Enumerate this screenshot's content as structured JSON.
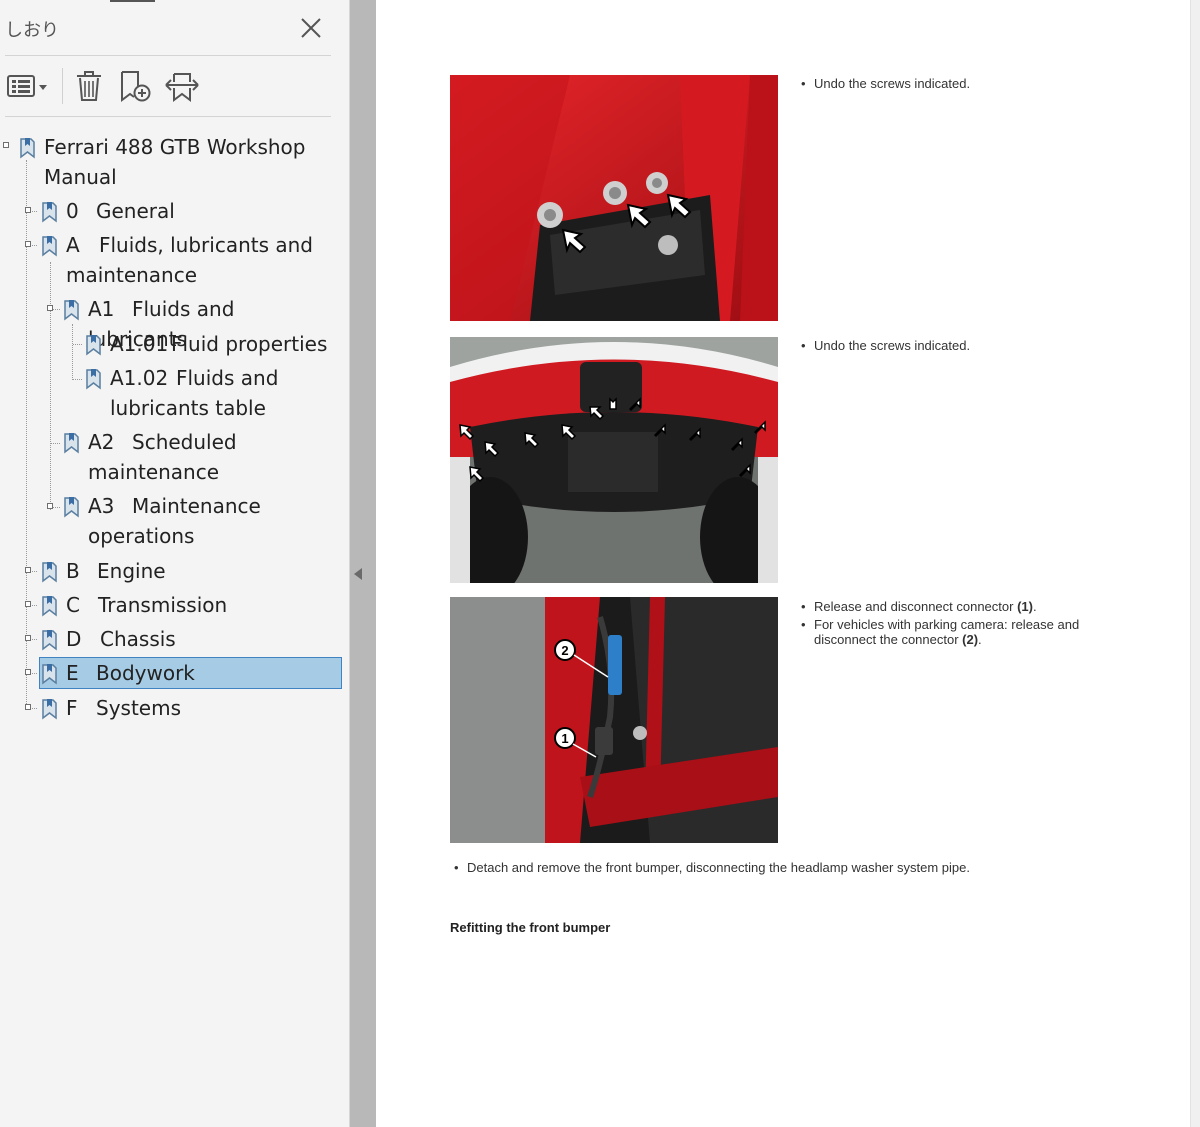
{
  "panel": {
    "title": "しおり",
    "tools": [
      "options-menu",
      "delete-bookmark",
      "add-bookmark",
      "expand-bookmark"
    ]
  },
  "tree": [
    {
      "prefix": "",
      "label": "Ferrari 488 GTB Workshop Manual",
      "level": 0,
      "expandable": true
    },
    {
      "prefix": "0",
      "label": "General",
      "level": 1,
      "expandable": true
    },
    {
      "prefix": "A",
      "label": "Fluids, lubricants and maintenance",
      "level": 1,
      "expandable": true
    },
    {
      "prefix": "A1",
      "label": "Fluids and lubricants",
      "level": 2,
      "expandable": true
    },
    {
      "prefix": "A1.01",
      "label": "Fluid properties",
      "level": 3,
      "expandable": false
    },
    {
      "prefix": "A1.02",
      "label": "Fluids and lubricants table",
      "level": 3,
      "expandable": false
    },
    {
      "prefix": "A2",
      "label": "Scheduled maintenance",
      "level": 2,
      "expandable": false
    },
    {
      "prefix": "A3",
      "label": "Maintenance operations",
      "level": 2,
      "expandable": true
    },
    {
      "prefix": "B",
      "label": "Engine",
      "level": 1,
      "expandable": true
    },
    {
      "prefix": "C",
      "label": "Transmission",
      "level": 1,
      "expandable": true
    },
    {
      "prefix": "D",
      "label": "Chassis",
      "level": 1,
      "expandable": true
    },
    {
      "prefix": "E",
      "label": "Bodywork",
      "level": 1,
      "expandable": true,
      "selected": true
    },
    {
      "prefix": "F",
      "label": "Systems",
      "level": 1,
      "expandable": true
    }
  ],
  "document": {
    "step1": {
      "items": [
        {
          "text": "Undo the screws indicated."
        }
      ]
    },
    "step2": {
      "items": [
        {
          "text": "Undo the screws indicated."
        }
      ]
    },
    "step3": {
      "items": [
        {
          "text": "Release and disconnect connector ",
          "bold": "(1)",
          "suffix": "."
        },
        {
          "text": "For vehicles with parking camera: release and disconnect the connector ",
          "bold": "(2)",
          "suffix": "."
        }
      ],
      "callouts": [
        "1",
        "2"
      ]
    },
    "step4": {
      "items": [
        {
          "text": "Detach and remove the front bumper, disconnecting the headlamp washer system pipe."
        }
      ]
    },
    "section_heading": "Refitting the front bumper"
  },
  "colors": {
    "selection": "#a6cbe5",
    "selection_border": "#3f83c2",
    "panel_bg": "#f4f4f4",
    "car_red": "#c8141b"
  }
}
